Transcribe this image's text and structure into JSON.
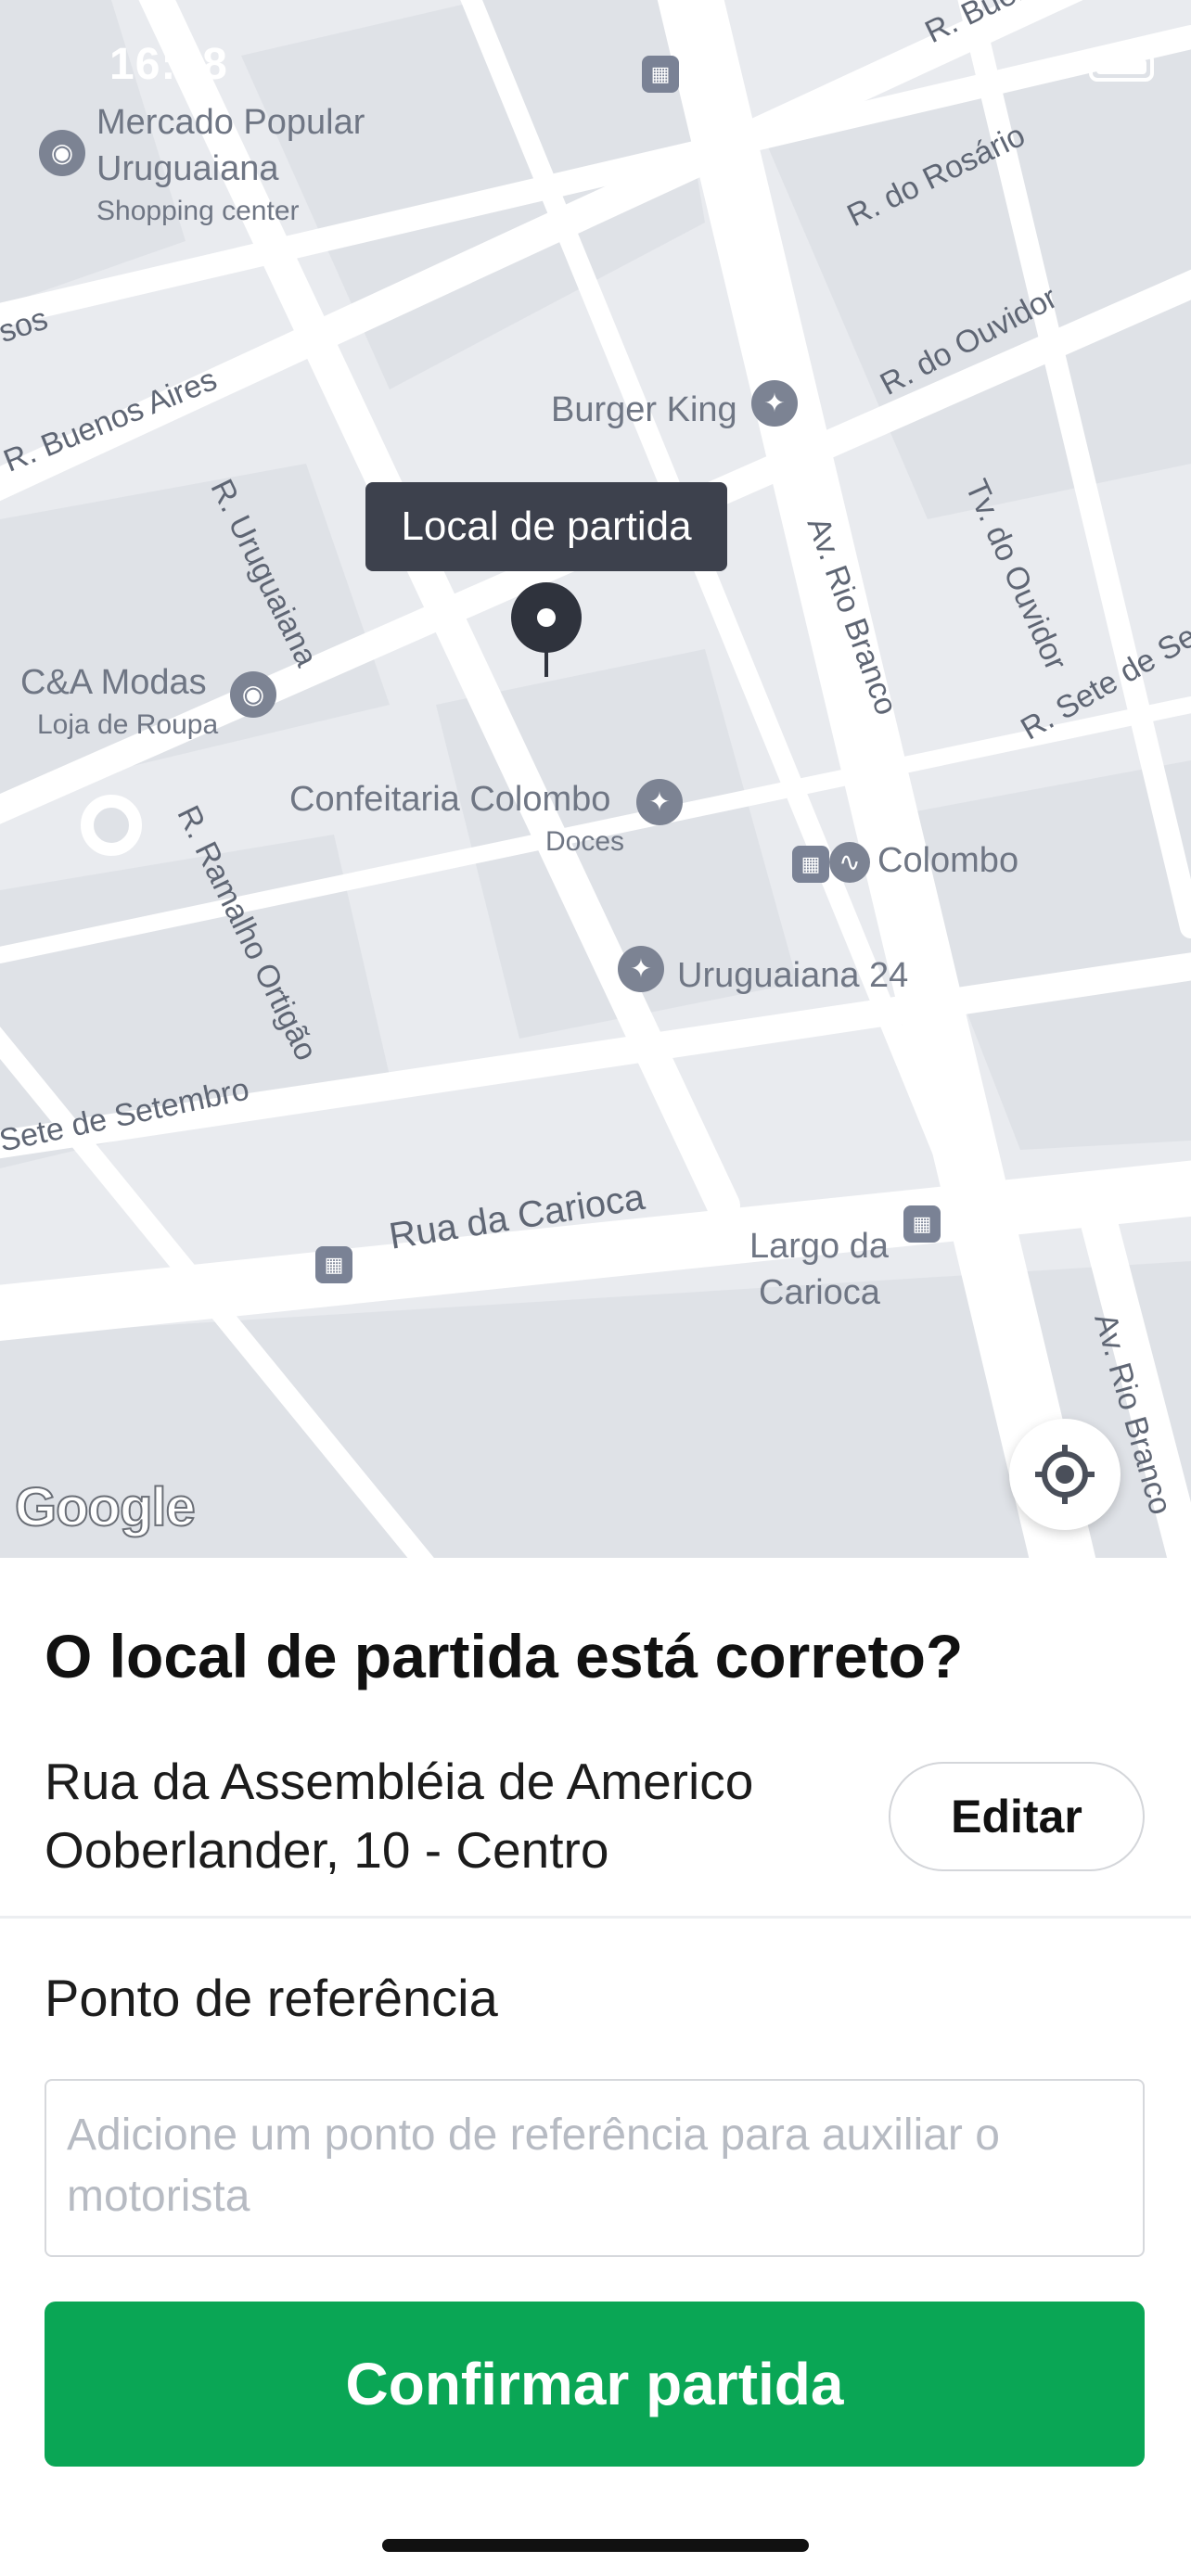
{
  "status_bar": {
    "time": "16:08"
  },
  "map": {
    "tooltip": "Local de partida",
    "google_logo": "Google",
    "places": {
      "mercado": {
        "name_line1": "Mercado Popular",
        "name_line2": "Uruguaiana",
        "category": "Shopping center"
      },
      "burger_king": {
        "name": "Burger King"
      },
      "cea": {
        "name": "C&A Modas",
        "category": "Loja de Roupa"
      },
      "confeitaria": {
        "name": "Confeitaria Colombo",
        "category": "Doces"
      },
      "colombo_station": {
        "name": "Colombo"
      },
      "uruguaiana24": {
        "name": "Uruguaiana 24"
      },
      "largo": {
        "name_line1": "Largo da",
        "name_line2": "Carioca"
      }
    },
    "streets": {
      "r_buenos_top": "R. Buenos",
      "r_rosario": "R. do Rosário",
      "sos": "sos",
      "r_ouvidor": "R. do Ouvidor",
      "r_buenos_aires": "R. Buenos Aires",
      "r_uruguaiana": "R. Uruguaiana",
      "av_rio_branco": "Av. Rio Branco",
      "tv_ouvidor": "Tv. do Ouvidor",
      "r_sete_set": "R. Sete de Set",
      "r_ramalho": "R. Ramalho Ortigão",
      "sete_setembro": "Sete de Setembro",
      "rua_carioca": "Rua da Carioca",
      "av_rio_branco_2": "Av. Rio Branco"
    }
  },
  "sheet": {
    "question": "O local de partida está correto?",
    "address_line1": "Rua da Assembléia de Americo",
    "address_line2": "Ooberlander, 10 - Centro",
    "edit_label": "Editar",
    "reference_label": "Ponto de referência",
    "reference_placeholder": "Adicione um ponto de referência para auxiliar o motorista",
    "reference_value": "",
    "confirm_label": "Confirmar partida"
  },
  "colors": {
    "accent": "#0aa655",
    "map_bg": "#e9ebef",
    "road": "#ffffff",
    "pin": "#2f333d"
  }
}
